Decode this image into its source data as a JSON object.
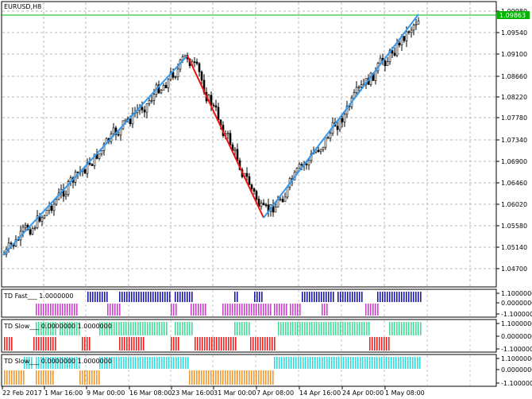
{
  "window": {
    "symbol_label": "EURUSD,H8"
  },
  "price_pane": {
    "y_ticks": [
      "1.09980",
      "1.09540",
      "1.09100",
      "1.08660",
      "1.08220",
      "1.07780",
      "1.07340",
      "1.06900",
      "1.06460",
      "1.06020",
      "1.05580",
      "1.05140",
      "1.04700"
    ],
    "current_price_label": "1.09863",
    "colors": {
      "current_price_line": "#00b400",
      "zigzag_up": "#3399ee",
      "zigzag_down": "#ee1111",
      "candles": "#000000"
    }
  },
  "indicator_panes": [
    {
      "label": "TD Fast___ 1.0000000",
      "y_ticks": [
        "1.1000000",
        "0.0000000",
        "-1.1000000"
      ],
      "colors": {
        "up": "#1a1aa6",
        "down": "#cc44cc"
      },
      "up_runs": [
        [
          110,
          135
        ],
        [
          150,
          215
        ],
        [
          220,
          242
        ],
        [
          295,
          300
        ],
        [
          320,
          330
        ],
        [
          380,
          420
        ],
        [
          425,
          455
        ],
        [
          475,
          530
        ]
      ],
      "down_runs": [
        [
          45,
          98
        ],
        [
          135,
          150
        ],
        [
          215,
          222
        ],
        [
          240,
          258
        ],
        [
          280,
          340
        ],
        [
          345,
          360
        ],
        [
          365,
          378
        ],
        [
          405,
          412
        ],
        [
          460,
          475
        ]
      ]
    },
    {
      "label": "TD Slow___ 0.0000000 1.0000000",
      "y_ticks": [
        "1.1000000",
        "0.0000000",
        "-1.1000000"
      ],
      "colors": {
        "up": "#44dd99",
        "down": "#ee2222"
      },
      "up_runs": [
        [
          45,
          70
        ],
        [
          75,
          100
        ],
        [
          125,
          210
        ],
        [
          220,
          243
        ],
        [
          295,
          315
        ],
        [
          350,
          465
        ],
        [
          490,
          530
        ]
      ],
      "down_runs": [
        [
          5,
          15
        ],
        [
          42,
          70
        ],
        [
          103,
          112
        ],
        [
          150,
          182
        ],
        [
          215,
          225
        ],
        [
          245,
          296
        ],
        [
          315,
          347
        ],
        [
          465,
          490
        ]
      ]
    },
    {
      "label": "TD Slow___ 0.0000000 1.0000000",
      "y_ticks": [
        "1.1000000",
        "0.0000000",
        "-1.1000000"
      ],
      "colors": {
        "up": "#33dddd",
        "down": "#ee9933"
      },
      "up_runs": [
        [
          30,
          40
        ],
        [
          45,
          100
        ],
        [
          125,
          238
        ],
        [
          345,
          530
        ]
      ],
      "down_runs": [
        [
          5,
          30
        ],
        [
          45,
          68
        ],
        [
          100,
          125
        ],
        [
          238,
          345
        ]
      ]
    }
  ],
  "x_axis": {
    "labels": [
      "22 Feb 2017",
      "1 Mar 16:00",
      "9 Mar 00:00",
      "16 Mar 08:00",
      "23 Mar 16:00",
      "31 Mar 00:00",
      "7 Apr 08:00",
      "14 Apr 16:00",
      "24 Apr 00:00",
      "1 May 08:00"
    ]
  }
}
